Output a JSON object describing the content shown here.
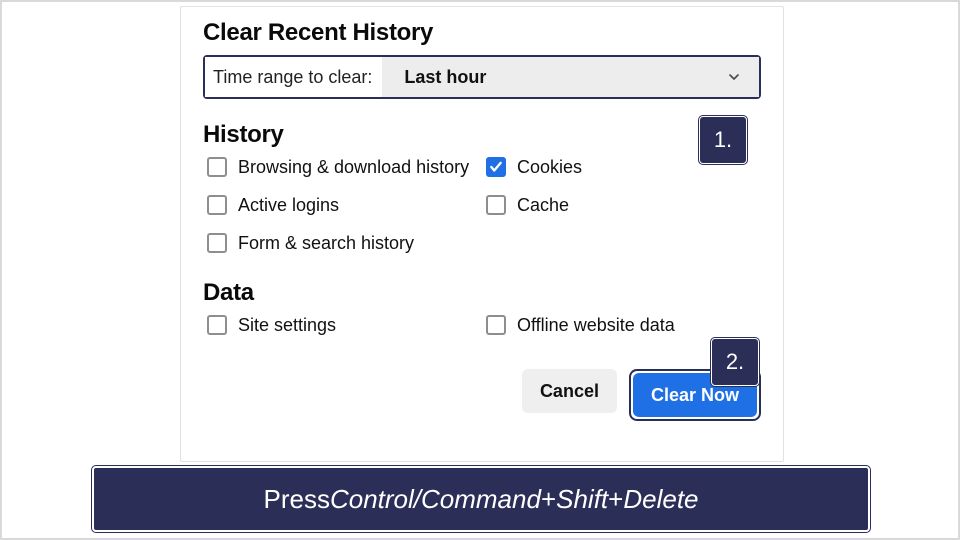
{
  "dialog": {
    "title": "Clear Recent History",
    "range_label": "Time range to clear:",
    "range_value": "Last hour",
    "history_heading": "History",
    "history_items": [
      {
        "label": "Browsing & download history",
        "checked": false
      },
      {
        "label": "Cookies",
        "checked": true
      },
      {
        "label": "Active logins",
        "checked": false
      },
      {
        "label": "Cache",
        "checked": false
      },
      {
        "label": "Form & search history",
        "checked": false
      }
    ],
    "data_heading": "Data",
    "data_items": [
      {
        "label": "Site settings",
        "checked": false
      },
      {
        "label": "Offline website data",
        "checked": false
      }
    ],
    "cancel_label": "Cancel",
    "clear_label": "Clear Now"
  },
  "callouts": {
    "one": "1.",
    "two": "2."
  },
  "banner": {
    "prefix": "Press ",
    "key1": "Control/Command",
    "plus": " + ",
    "key2": "Shift",
    "key3": "Delete"
  },
  "colors": {
    "accent": "#1f6fe5",
    "callout_bg": "#2b2f57"
  }
}
